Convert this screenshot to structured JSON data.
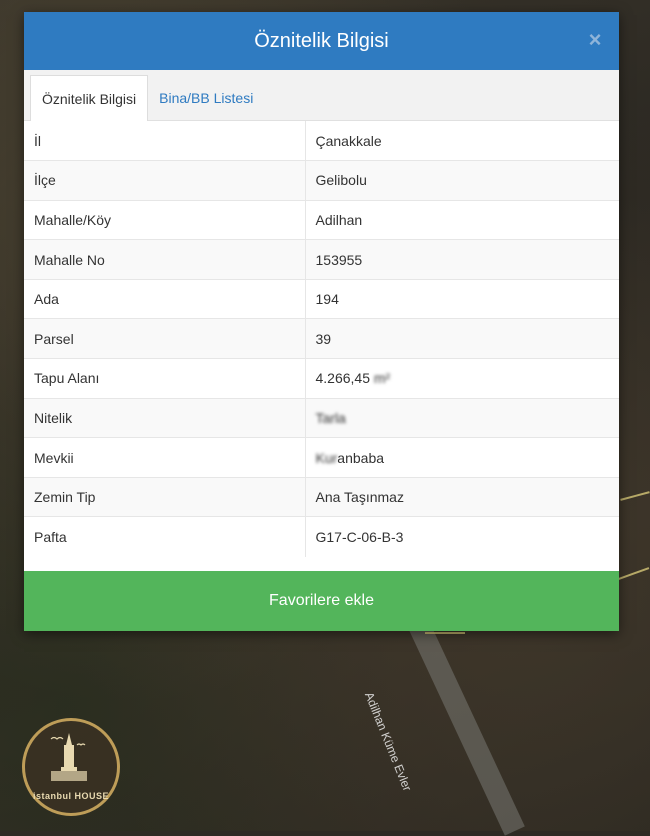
{
  "modal": {
    "title": "Öznitelik Bilgisi",
    "close_icon": "close-icon"
  },
  "tabs": [
    {
      "label": "Öznitelik Bilgisi",
      "active": true
    },
    {
      "label": "Bina/BB Listesi",
      "active": false
    }
  ],
  "attributes": [
    {
      "key": "İl",
      "value": "Çanakkale"
    },
    {
      "key": "İlçe",
      "value": "Gelibolu"
    },
    {
      "key": "Mahalle/Köy",
      "value": "Adilhan"
    },
    {
      "key": "Mahalle No",
      "value": "153955"
    },
    {
      "key": "Ada",
      "value": "194"
    },
    {
      "key": "Parsel",
      "value": "39"
    },
    {
      "key": "Tapu Alanı",
      "value": "4.266,45",
      "value_suffix_obscured": "m²"
    },
    {
      "key": "Nitelik",
      "value": "Tarla",
      "obscured": true
    },
    {
      "key": "Mevkii",
      "value": "anbaba",
      "value_prefix_obscured": "Kur"
    },
    {
      "key": "Zemin Tip",
      "value": "Ana Taşınmaz"
    },
    {
      "key": "Pafta",
      "value": "G17-C-06-B-3"
    }
  ],
  "favorite_button": {
    "label": "Favorilere ekle"
  },
  "map": {
    "road_label": "Adilhan Küme Evler",
    "watermark_text": "istanbul HOUSE"
  },
  "colors": {
    "header": "#2f7bc1",
    "favorite_button": "#53b55b",
    "tab_inactive_text": "#2f7bc1"
  }
}
